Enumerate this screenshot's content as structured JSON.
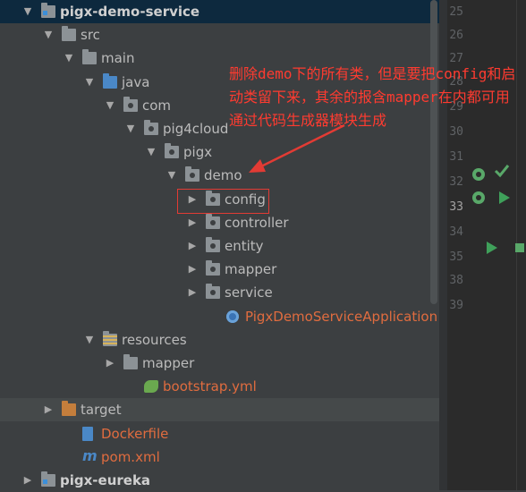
{
  "tree": [
    {
      "label": "pigx-demo-service",
      "level": 0,
      "arrow": "▼",
      "icon": "module",
      "style": "bold",
      "selected": true
    },
    {
      "label": "src",
      "level": 1,
      "arrow": "▼",
      "icon": "folder"
    },
    {
      "label": "main",
      "level": 2,
      "arrow": "▼",
      "icon": "folder"
    },
    {
      "label": "java",
      "level": 3,
      "arrow": "▼",
      "icon": "src"
    },
    {
      "label": "com",
      "level": 4,
      "arrow": "▼",
      "icon": "package"
    },
    {
      "label": "pig4cloud",
      "level": 5,
      "arrow": "▼",
      "icon": "package"
    },
    {
      "label": "pigx",
      "level": 6,
      "arrow": "▼",
      "icon": "package"
    },
    {
      "label": "demo",
      "level": 7,
      "arrow": "▼",
      "icon": "package"
    },
    {
      "label": "config",
      "level": 8,
      "arrow": "▶",
      "icon": "package"
    },
    {
      "label": "controller",
      "level": 8,
      "arrow": "▶",
      "icon": "package"
    },
    {
      "label": "entity",
      "level": 8,
      "arrow": "▶",
      "icon": "package"
    },
    {
      "label": "mapper",
      "level": 8,
      "arrow": "▶",
      "icon": "package"
    },
    {
      "label": "service",
      "level": 8,
      "arrow": "▶",
      "icon": "package"
    },
    {
      "label": "PigxDemoServiceApplication",
      "level": 9,
      "arrow": "",
      "icon": "spring-app",
      "style": "red"
    },
    {
      "label": "resources",
      "level": 3,
      "arrow": "▼",
      "icon": "resources"
    },
    {
      "label": "mapper",
      "level": 4,
      "arrow": "▶",
      "icon": "folder"
    },
    {
      "label": "bootstrap.yml",
      "level": 5,
      "arrow": "",
      "icon": "yml",
      "style": "red"
    },
    {
      "label": "target",
      "level": 1,
      "arrow": "▶",
      "icon": "target",
      "highlight": true
    },
    {
      "label": "Dockerfile",
      "level": 2,
      "arrow": "",
      "icon": "docker",
      "style": "red"
    },
    {
      "label": "pom.xml",
      "level": 2,
      "arrow": "",
      "icon": "maven",
      "style": "red"
    },
    {
      "label": "pigx-eureka",
      "level": 0,
      "arrow": "▶",
      "icon": "module",
      "style": "bold"
    }
  ],
  "line_numbers": [
    "25",
    "26",
    "27",
    "28",
    "29",
    "30",
    "31",
    "32",
    "33",
    "34",
    "35",
    "38",
    "39"
  ],
  "current_line": "33",
  "annotation": {
    "text": "删除demo下的所有类，但是要把config和启动类留下来，其余的报含mapper在内都可用通过代码生成器模块生成"
  }
}
